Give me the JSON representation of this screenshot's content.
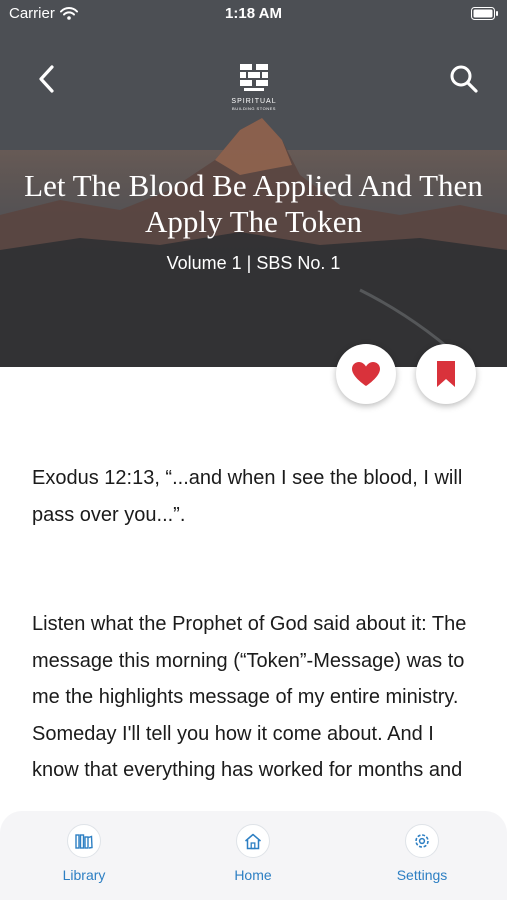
{
  "status_bar": {
    "carrier": "Carrier",
    "time": "1:18 AM"
  },
  "header": {
    "logo_text": "SPIRITUAL",
    "logo_subtext": "BUILDING STONES",
    "back_icon": "chevron-left-icon",
    "search_icon": "search-icon"
  },
  "sermon": {
    "title": "Let The Blood Be Applied And Then Apply The Token",
    "subtitle": "Volume 1 | SBS No. 1"
  },
  "actions": {
    "favorite_icon": "heart-icon",
    "bookmark_icon": "bookmark-icon",
    "accent_color": "#d9323b"
  },
  "body": {
    "paragraph1": "Exodus 12:13, “...and when I see the blood, I will pass over you...”.",
    "paragraph2": " Listen what the Prophet of God said about it: The message this morning (“Token”-Message) was to me the highlights message of my entire ministry. Someday I'll tell you how it come about. And I know that everything has worked for months and"
  },
  "tab_bar": {
    "tint_color": "#2d7fc3",
    "items": [
      {
        "label": "Library",
        "icon": "library-icon"
      },
      {
        "label": "Home",
        "icon": "home-icon"
      },
      {
        "label": "Settings",
        "icon": "settings-icon"
      }
    ]
  }
}
